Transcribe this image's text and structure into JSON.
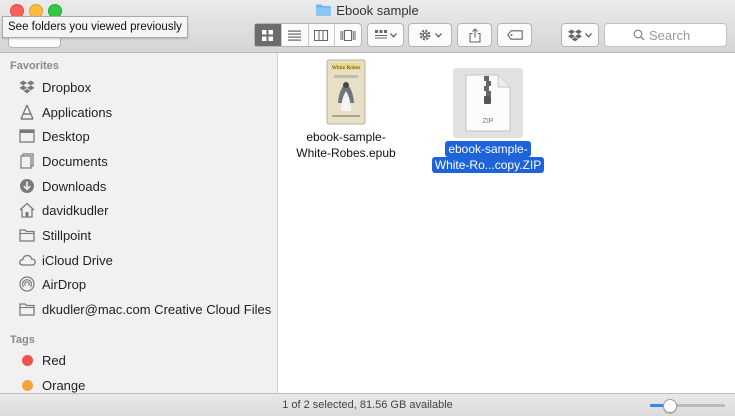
{
  "window": {
    "title": "Ebook sample",
    "tooltip": "See folders you viewed previously"
  },
  "toolbar": {
    "search_placeholder": "Search",
    "view_modes": [
      "icon-view",
      "list-view",
      "column-view",
      "cover-flow-view"
    ],
    "active_view": "icon-view"
  },
  "sidebar": {
    "favorites_heading": "Favorites",
    "items": [
      {
        "label": "Dropbox",
        "icon": "dropbox-icon"
      },
      {
        "label": "Applications",
        "icon": "applications-icon"
      },
      {
        "label": "Desktop",
        "icon": "desktop-icon"
      },
      {
        "label": "Documents",
        "icon": "documents-icon"
      },
      {
        "label": "Downloads",
        "icon": "downloads-icon"
      },
      {
        "label": "davidkudler",
        "icon": "home-icon"
      },
      {
        "label": "Stillpoint",
        "icon": "folder-icon"
      },
      {
        "label": "iCloud Drive",
        "icon": "cloud-icon"
      },
      {
        "label": "AirDrop",
        "icon": "airdrop-icon"
      },
      {
        "label": "dkudler@mac.com Creative Cloud Files",
        "icon": "folder-icon"
      }
    ],
    "tags_heading": "Tags",
    "tags": [
      {
        "label": "Red",
        "color": "#f1514b"
      },
      {
        "label": "Orange",
        "color": "#f5a33b"
      }
    ]
  },
  "files": [
    {
      "line1": "ebook-sample-",
      "line2": "White-Robes.epub",
      "selected": false,
      "cover_text": "White Robes"
    },
    {
      "line1": "ebook-sample-",
      "line2": "White-Ro...copy.ZIP",
      "selected": true,
      "badge": "ZIP"
    }
  ],
  "status": {
    "text": "1 of 2 selected, 81.56 GB available",
    "icon_size_level": 0.25
  },
  "colors": {
    "selection": "#1d63d9",
    "active_segment": "#6c6c6c"
  }
}
